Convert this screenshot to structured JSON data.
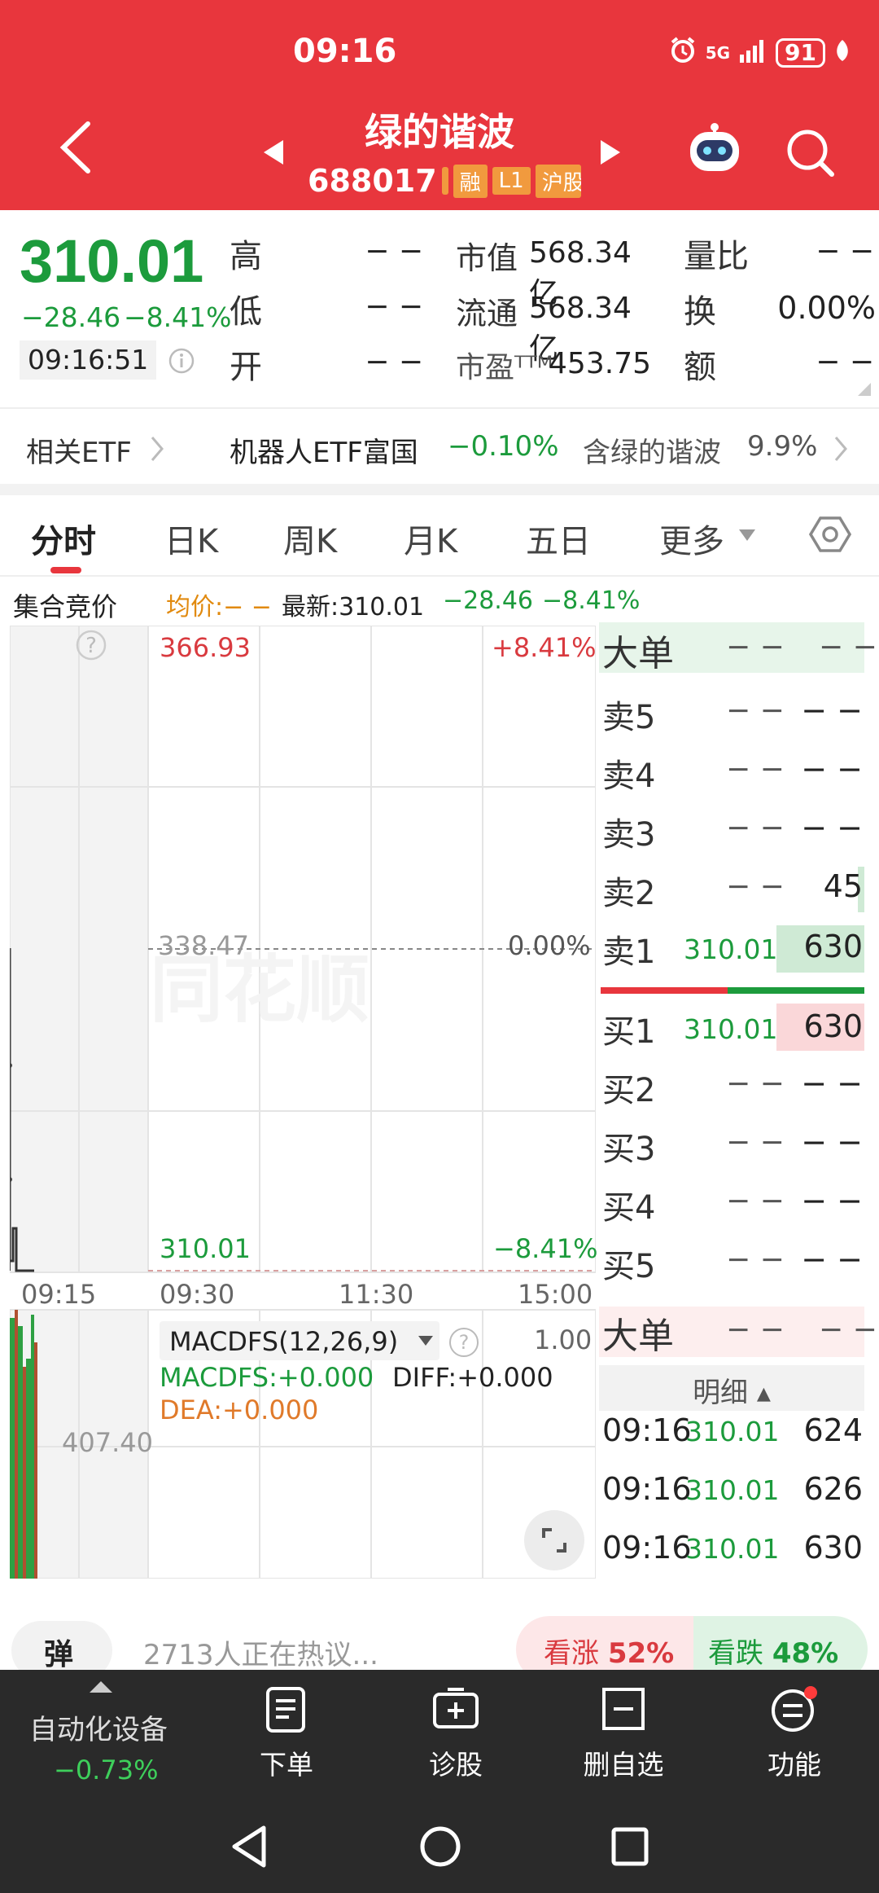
{
  "status": {
    "time": "09:16",
    "battery": "91",
    "network": "5G"
  },
  "header": {
    "title": "绿的谐波",
    "code": "688017",
    "tags": [
      "融",
      "L1",
      "沪股"
    ]
  },
  "quote": {
    "price": "310.01",
    "change": "−28.46",
    "change_pct": "−8.41%",
    "time": "09:16:51",
    "high_label": "高",
    "high": "− −",
    "low_label": "低",
    "low": "− −",
    "open_label": "开",
    "open": "− −",
    "mktcap_label": "市值",
    "mktcap": "568.34亿",
    "float_label": "流通",
    "float": "568.34亿",
    "pe_label": "市盈ᵀᵀᴹ",
    "pe": "453.75",
    "vr_label": "量比",
    "vr": "− −",
    "turnover_label": "换",
    "turnover": "0.00%",
    "amount_label": "额",
    "amount": "− −"
  },
  "etf": {
    "label": "相关ETF",
    "name": "机器人ETF富国",
    "pct": "−0.10%",
    "hold_label": "含绿的谐波",
    "hold": "9.9%"
  },
  "tabs": [
    "分时",
    "日K",
    "周K",
    "月K",
    "五日",
    "更多"
  ],
  "info_row": {
    "label": "集合竞价",
    "avg": "均价:− −",
    "latest": "最新:310.01",
    "chg": "−28.46",
    "pct": "−8.41%"
  },
  "chart": {
    "top_price": "366.93",
    "top_pct": "+8.41%",
    "mid_price": "338.47",
    "mid_pct": "0.00%",
    "bot_price": "310.01",
    "bot_pct": "−8.41%",
    "times": [
      "09:15",
      "09:30",
      "11:30",
      "15:00"
    ],
    "macd_title": "MACDFS(12,26,9)",
    "macd_scale": "1.00",
    "macdfs": "MACDFS:+0.000",
    "diff": "DIFF:+0.000",
    "dea": "DEA:+0.000",
    "vol_label": "407.40",
    "watermark": "同花顺"
  },
  "orderbook": {
    "big_order": "大单",
    "dash": "− −",
    "sell": [
      {
        "label": "卖5",
        "price": "− −",
        "vol": "− −"
      },
      {
        "label": "卖4",
        "price": "− −",
        "vol": "− −"
      },
      {
        "label": "卖3",
        "price": "− −",
        "vol": "− −"
      },
      {
        "label": "卖2",
        "price": "− −",
        "vol": "45"
      },
      {
        "label": "卖1",
        "price": "310.01",
        "vol": "630"
      }
    ],
    "buy": [
      {
        "label": "买1",
        "price": "310.01",
        "vol": "630"
      },
      {
        "label": "买2",
        "price": "− −",
        "vol": "− −"
      },
      {
        "label": "买3",
        "price": "− −",
        "vol": "− −"
      },
      {
        "label": "买4",
        "price": "− −",
        "vol": "− −"
      },
      {
        "label": "买5",
        "price": "− −",
        "vol": "− −"
      }
    ],
    "detail_label": "明细 ▴",
    "ticks": [
      {
        "time": "09:16",
        "price": "310.01",
        "vol": "624"
      },
      {
        "time": "09:16",
        "price": "310.01",
        "vol": "626"
      },
      {
        "time": "09:16",
        "price": "310.01",
        "vol": "630"
      }
    ]
  },
  "comment": {
    "btn": "弹",
    "text": "2713人正在热议...",
    "bull_label": "看涨",
    "bull_pct": "52%",
    "bear_label": "看跌",
    "bear_pct": "48%"
  },
  "bottom": {
    "sector": "自动化设备",
    "sector_pct": "−0.73%",
    "items": [
      "下单",
      "诊股",
      "删自选",
      "功能"
    ]
  },
  "colors": {
    "brand": "#e8363d",
    "down": "#1c9b3c",
    "up": "#d93a3f",
    "avg": "#e18a0f"
  }
}
